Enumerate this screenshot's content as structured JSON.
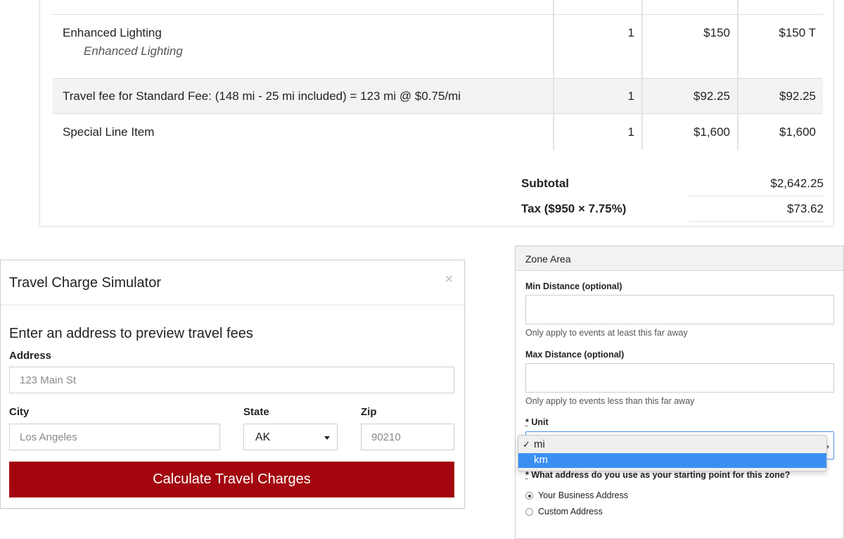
{
  "invoice": {
    "rows": [
      {
        "desc": "Enhanced Lighting",
        "sub": "Enhanced Lighting",
        "qty": "1",
        "price": "$150",
        "total": "$150 T"
      },
      {
        "desc": "Travel fee for Standard Fee: (148 mi - 25 mi included) = 123 mi @ $0.75/mi",
        "qty": "1",
        "price": "$92.25",
        "total": "$92.25"
      },
      {
        "desc": "Special Line Item",
        "qty": "1",
        "price": "$1,600",
        "total": "$1,600"
      }
    ],
    "subtotal_label": "Subtotal",
    "subtotal_value": "$2,642.25",
    "tax_label": "Tax ($950 × 7.75%)",
    "tax_value": "$73.62"
  },
  "simulator": {
    "title": "Travel Charge Simulator",
    "close_glyph": "×",
    "subtitle": "Enter an address to preview travel fees",
    "address_label": "Address",
    "address_placeholder": "123 Main St",
    "city_label": "City",
    "city_placeholder": "Los Angeles",
    "state_label": "State",
    "state_value": "AK",
    "zip_label": "Zip",
    "zip_placeholder": "90210",
    "button_label": "Calculate Travel Charges",
    "button_color": "#a3060f"
  },
  "zone": {
    "title": "Zone Area",
    "min_label": "Min Distance (optional)",
    "min_help": "Only apply to events at least this far away",
    "max_label": "Max Distance (optional)",
    "max_help": "Only apply to events less than this far away",
    "unit_required": "*",
    "unit_label": " Unit",
    "unit_options": [
      {
        "label": "mi",
        "checked": "✓"
      },
      {
        "label": "km"
      }
    ],
    "start_required": "*",
    "start_label": " What address do you use as your starting point for this zone?",
    "radio_business": "Your Business Address",
    "radio_custom": "Custom Address"
  }
}
